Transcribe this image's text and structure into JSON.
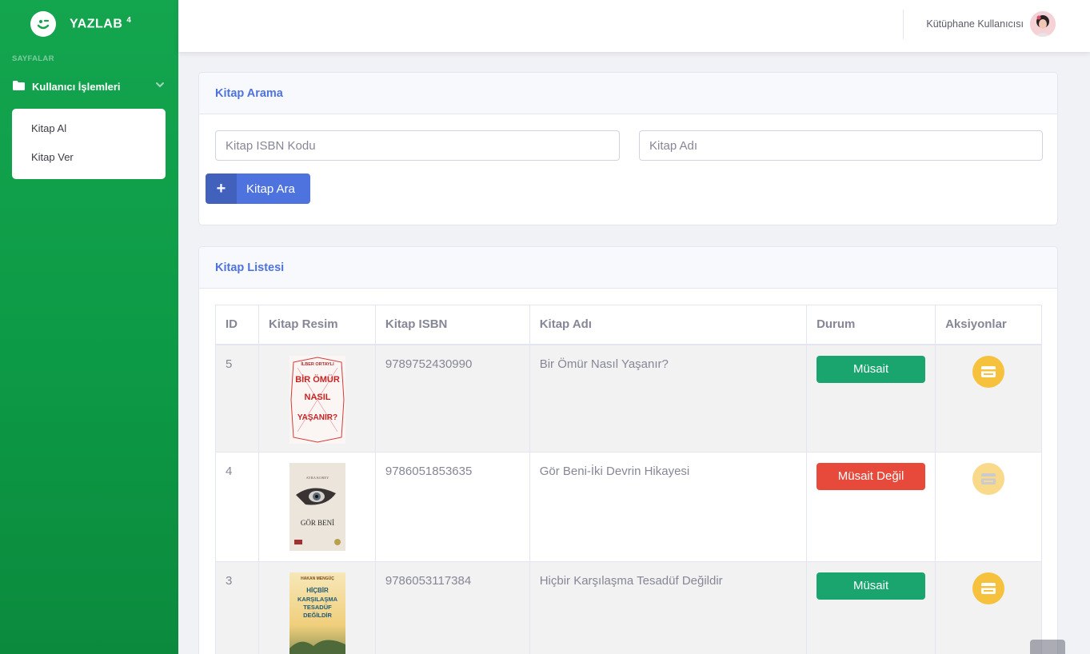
{
  "brand": {
    "name": "YAZLAB",
    "superscript": "4"
  },
  "sidebar": {
    "heading": "SAYFALAR",
    "nav": {
      "label": "Kullanıcı İşlemleri"
    },
    "submenu": [
      {
        "label": "Kitap Al"
      },
      {
        "label": "Kitap Ver"
      }
    ]
  },
  "topbar": {
    "user_name": "Kütüphane Kullanıcısı"
  },
  "search": {
    "title": "Kitap Arama",
    "isbn_placeholder": "Kitap ISBN Kodu",
    "name_placeholder": "Kitap Adı",
    "button_icon": "+",
    "button_label": "Kitap Ara"
  },
  "list": {
    "title": "Kitap Listesi",
    "columns": [
      "ID",
      "Kitap Resim",
      "Kitap ISBN",
      "Kitap Adı",
      "Durum",
      "Aksiyonlar"
    ],
    "rows": [
      {
        "id": "5",
        "isbn": "9789752430990",
        "name": "Bir Ömür Nasıl Yaşanır?",
        "status": "Müsait"
      },
      {
        "id": "4",
        "isbn": "9786051853635",
        "name": "Gör Beni-İki Devrin Hikayesi",
        "status": "Müsait Değil"
      },
      {
        "id": "3",
        "isbn": "9786053117384",
        "name": "Hiçbir Karşılaşma Tesadüf Değildir",
        "status": "Müsait"
      }
    ]
  },
  "covers": {
    "book1": {
      "author": "İLBER ORTAYLI",
      "line1": "BİR ÖMÜR",
      "line2": "NASIL",
      "line3": "YAŞANIR?"
    },
    "book2": {
      "author": "AYRA KOREY",
      "title": "GÖR BENİ"
    },
    "book3": {
      "author": "HAKAN MENGÜÇ",
      "line1": "HİÇBİR",
      "line2": "KARŞILAŞMA",
      "line3": "TESADÜF",
      "line4": "DEĞİLDİR"
    }
  },
  "colors": {
    "primary": "#4e73df",
    "success": "#1aa56f",
    "danger": "#e74a3b",
    "warning": "#f6c23e",
    "sidebar": "#14a54f"
  }
}
